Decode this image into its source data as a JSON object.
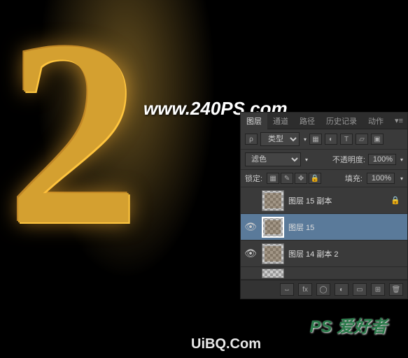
{
  "canvas": {
    "main_character": "2",
    "watermark_url": "www.240PS.com",
    "watermark_bottom": "UiBQ.Com",
    "watermark_ps": "PS 爱好者"
  },
  "panel": {
    "tabs": {
      "layers": "图层",
      "channels": "通道",
      "paths": "路径",
      "history": "历史记录",
      "actions": "动作"
    },
    "filter_row": {
      "kind_icon": "ρ",
      "kind_label": "类型"
    },
    "blend_row": {
      "mode": "滤色",
      "opacity_label": "不透明度:",
      "opacity_value": "100%"
    },
    "lock_row": {
      "lock_label": "锁定:",
      "fill_label": "填充:",
      "fill_value": "100%"
    },
    "layers": [
      {
        "visible": "",
        "name": "图层 15 副本",
        "locked": true,
        "selected": false
      },
      {
        "visible": "👁",
        "name": "图层 15",
        "locked": false,
        "selected": true
      },
      {
        "visible": "👁",
        "name": "图层 14 副本 2",
        "locked": false,
        "selected": false
      }
    ],
    "bottom_icons": {
      "link": "⇔",
      "fx": "fx",
      "mask": "◯",
      "adjust": "◐",
      "group": "▭",
      "new": "⊞",
      "trash": "🗑"
    }
  }
}
